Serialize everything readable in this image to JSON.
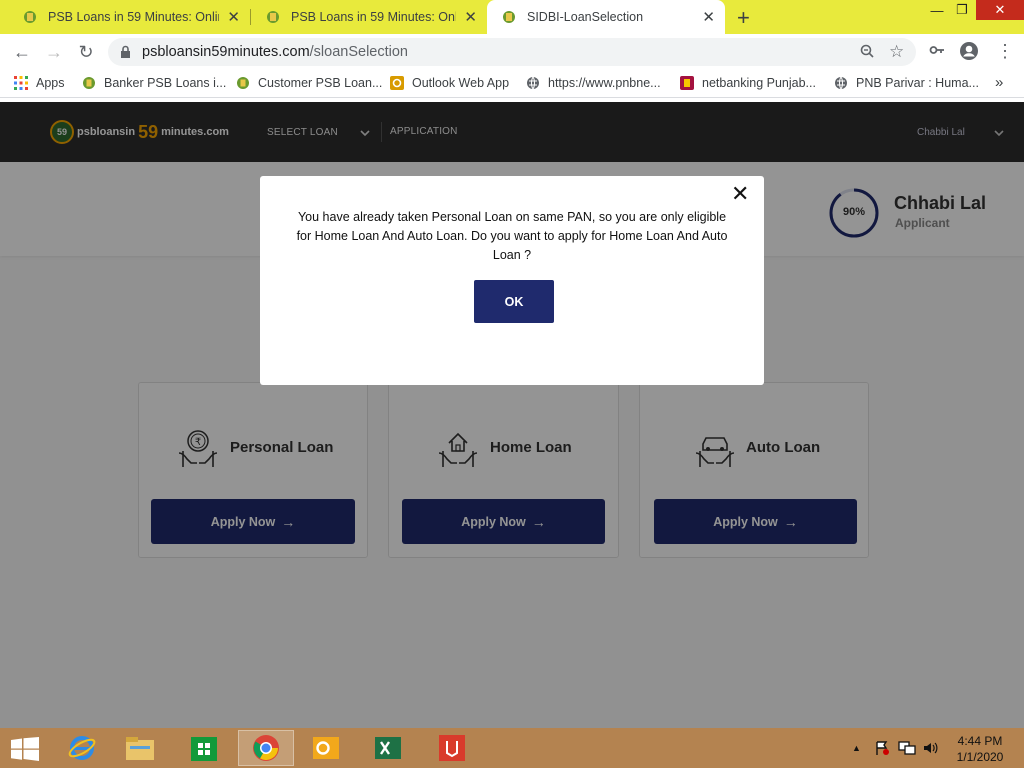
{
  "browser": {
    "tabs": [
      {
        "title": "PSB Loans in 59 Minutes: Online",
        "active": false
      },
      {
        "title": "PSB Loans in 59 Minutes: Online",
        "active": false
      },
      {
        "title": "SIDBI-LoanSelection",
        "active": true
      }
    ],
    "url_host": "psbloansin59minutes.com",
    "url_path": "/sloanSelection",
    "bookmarks": [
      {
        "label": "Apps"
      },
      {
        "label": "Banker PSB Loans i..."
      },
      {
        "label": "Customer PSB Loan..."
      },
      {
        "label": "Outlook Web App"
      },
      {
        "label": "https://www.pnbne..."
      },
      {
        "label": "netbanking Punjab..."
      },
      {
        "label": "PNB Parivar : Huma..."
      }
    ],
    "bookmarks_more": "»"
  },
  "site": {
    "logo_prefix": "psbloansin",
    "logo_num": "59",
    "logo_suffix": "minutes.com",
    "logo_badge": "59",
    "nav_select_loan": "SELECT LOAN",
    "nav_application": "APPLICATION",
    "header_user": "Chabbi Lal",
    "progress": {
      "value": 0.9,
      "label": "90%"
    },
    "applicant_name": "Chhabi Lal",
    "applicant_role": "Applicant",
    "loans": [
      {
        "title": "Personal Loan",
        "button": "Apply Now",
        "icon": "rupee-hands-icon"
      },
      {
        "title": "Home Loan",
        "button": "Apply Now",
        "icon": "house-hands-icon"
      },
      {
        "title": "Auto Loan",
        "button": "Apply Now",
        "icon": "car-hands-icon"
      }
    ]
  },
  "modal": {
    "message": "You have already taken Personal Loan on same PAN, so you are only eligible for Home Loan And Auto Loan. Do you want to apply for Home Loan And Auto Loan ?",
    "ok_label": "OK"
  },
  "taskbar": {
    "time": "4:44 PM",
    "date": "1/1/2020"
  },
  "colors": {
    "tabstrip": "#e8ea3c",
    "brand_navy": "#1f2a6d",
    "header_dark": "#2e2e2e",
    "taskbar": "#b48350",
    "logo_accent": "#f7a600"
  }
}
